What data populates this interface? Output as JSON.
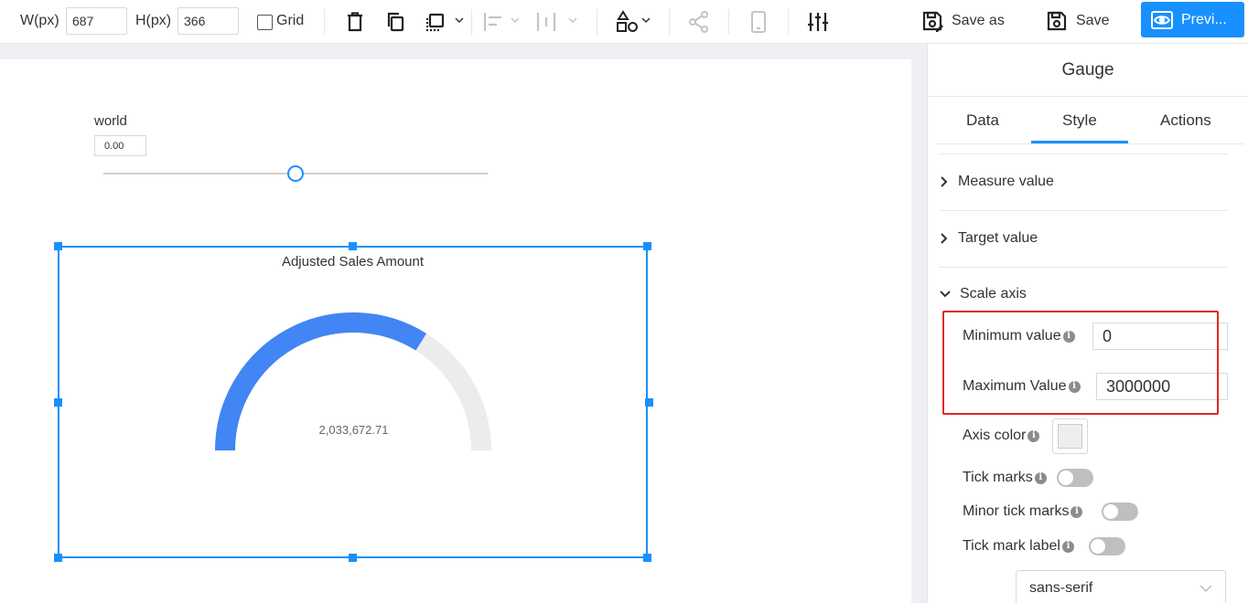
{
  "toolbar": {
    "width_label": "W(px)",
    "width_value": "687",
    "height_label": "H(px)",
    "height_value": "366",
    "grid_label": "Grid",
    "grid_checked": false,
    "save_as_label": "Save as",
    "save_label": "Save",
    "preview_label": "Previ...",
    "preview_color": "#1890ff"
  },
  "canvas": {
    "slider": {
      "label": "world",
      "value": "0.00",
      "position_fraction": 0.5
    },
    "chart": {
      "title": "Adjusted Sales Amount",
      "value_label": "2,033,672.71"
    }
  },
  "chart_data": {
    "type": "gauge",
    "title": "Adjusted Sales Amount",
    "value": 2033672.71,
    "min": 0,
    "max": 3000000,
    "fill_color": "#4285f4",
    "track_color": "#ececec"
  },
  "panel": {
    "title": "Gauge",
    "tabs": [
      "Data",
      "Style",
      "Actions"
    ],
    "active_tab": "Style",
    "sections": {
      "measure_value": "Measure value",
      "target_value": "Target value",
      "scale_axis": "Scale axis"
    },
    "fields": {
      "minimum_label": "Minimum value",
      "minimum_value": "0",
      "maximum_label": "Maximum Value",
      "maximum_value": "3000000",
      "axis_color_label": "Axis color",
      "axis_color": "#eeeeee",
      "tick_marks_label": "Tick marks",
      "minor_tick_marks_label": "Minor tick marks",
      "tick_mark_label_label": "Tick mark label",
      "font_select_value": "sans-serif"
    },
    "highlight_color": "#e0281e"
  }
}
